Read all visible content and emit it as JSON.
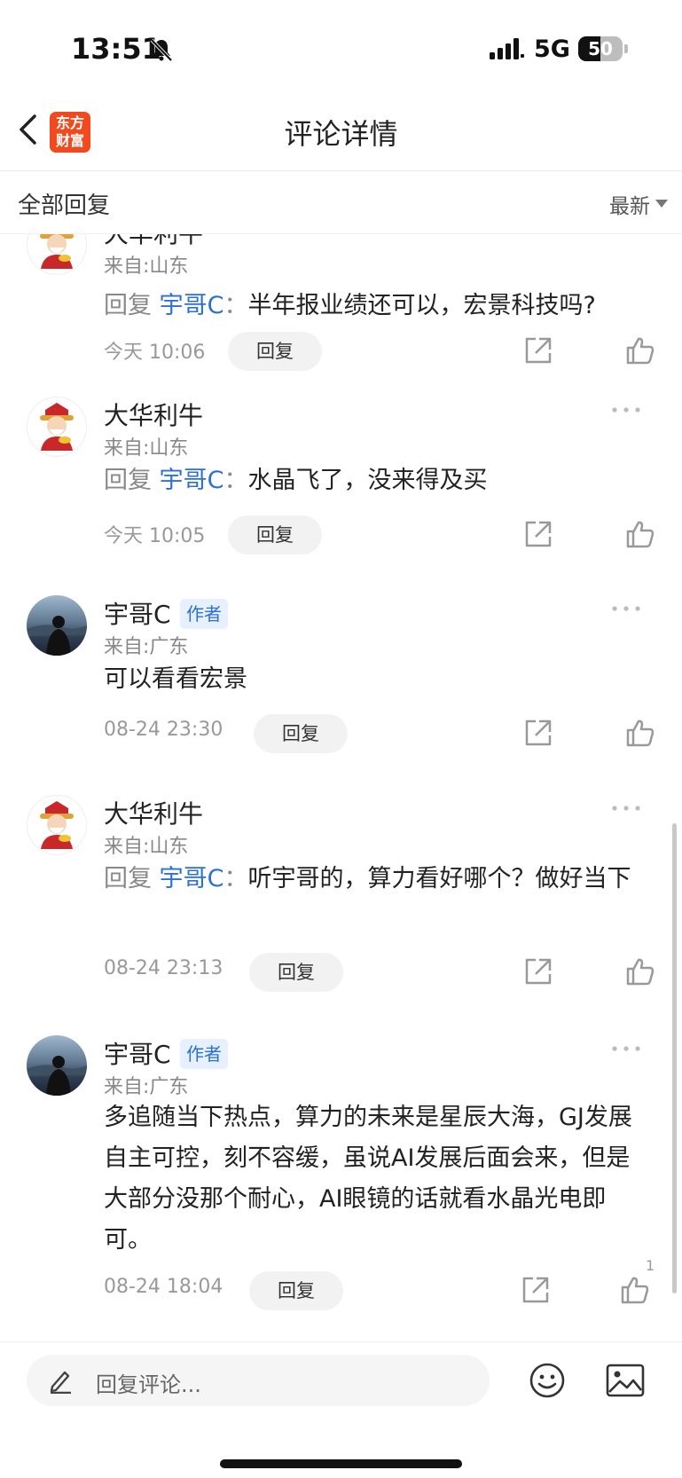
{
  "status_bar": {
    "time": "13:51",
    "network": "5G",
    "battery_level": "50",
    "battery_fraction": 0.5
  },
  "nav": {
    "logo_line1": "东方",
    "logo_line2": "财富",
    "title": "评论详情"
  },
  "section": {
    "label": "全部回复",
    "sort": "最新"
  },
  "comments": [
    {
      "name": "大华利牛",
      "from": "来自:山东",
      "reply_prefix": "回复",
      "reply_target": "宇哥C",
      "reply_sep": "：",
      "text": "半年报业绩还可以，宏景科技吗?",
      "time": "今天 10:06",
      "reply_label": "回复"
    },
    {
      "name": "大华利牛",
      "from": "来自:山东",
      "reply_prefix": "回复",
      "reply_target": "宇哥C",
      "reply_sep": "：",
      "text": "水晶飞了，没来得及买",
      "time": "今天 10:05",
      "reply_label": "回复"
    },
    {
      "name": "宇哥C",
      "badge": "作者",
      "from": "来自:广东",
      "text": "可以看看宏景",
      "time": "08-24 23:30",
      "reply_label": "回复"
    },
    {
      "name": "大华利牛",
      "from": "来自:山东",
      "reply_prefix": "回复",
      "reply_target": "宇哥C",
      "reply_sep": "：",
      "text": "听宇哥的，算力看好哪个？做好当下",
      "time": "08-24 23:13",
      "reply_label": "回复"
    },
    {
      "name": "宇哥C",
      "badge": "作者",
      "from": "来自:广东",
      "text": "多追随当下热点，算力的未来是星辰大海，GJ发展自主可控，刻不容缓，虽说AI发展后面会来，但是大部分没那个耐心，AI眼镜的话就看水晶光电即可。",
      "time": "08-24 18:04",
      "reply_label": "回复",
      "like_count": "1"
    }
  ],
  "input": {
    "placeholder": "回复评论..."
  },
  "icons": [
    "bell-slash-icon",
    "signal-icon",
    "back-icon",
    "more-icon",
    "share-icon",
    "like-icon",
    "pen-icon",
    "emoji-icon",
    "image-icon"
  ],
  "colors": {
    "accent_blue": "#2b6fd8",
    "logo_orange": "#f04a1e"
  }
}
